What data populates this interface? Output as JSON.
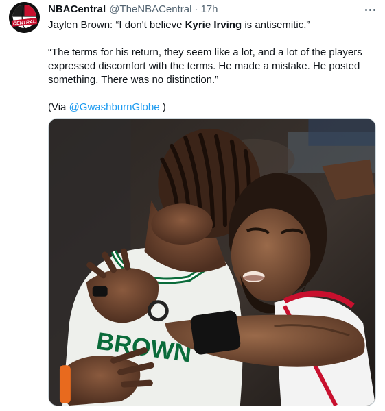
{
  "tweet": {
    "author_name": "NBACentral",
    "author_handle": "@TheNBACentral",
    "separator": "·",
    "time": "17h",
    "logo_text": "CENTRAL",
    "text": {
      "line1_pre": "Jaylen Brown: “I don't believe ",
      "line1_bold": "Kyrie Irving",
      "line1_post": " is antisemitic,”",
      "quote_lines": [
        "“The terms for his return, they seem like a lot, and a lot of the players",
        "expressed discomfort with the terms. He made a mistake. He posted",
        "something. There was no distinction.”"
      ],
      "via_open": "(Via ",
      "via_mention": "@GwashburnGlobe",
      "via_close": " )"
    },
    "media_jersey_text": "BROWN"
  },
  "colors": {
    "text": "#0f1419",
    "secondary": "#536471",
    "link": "#1d9bf0",
    "celtics_green": "#007a33",
    "nets_red": "#c8102e"
  }
}
